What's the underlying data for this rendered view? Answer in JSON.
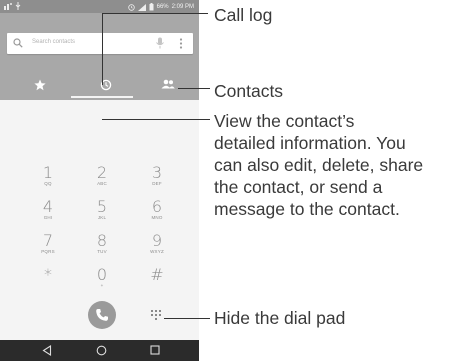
{
  "status_bar": {
    "battery": "66%",
    "time": "2:09 PM"
  },
  "search": {
    "placeholder": "Search contacts"
  },
  "tabs": [
    {
      "name": "favorites",
      "icon": "star-icon"
    },
    {
      "name": "call-log",
      "icon": "clock-icon",
      "selected": true
    },
    {
      "name": "contacts",
      "icon": "people-icon"
    }
  ],
  "dialpad": {
    "keys": [
      {
        "num": "1",
        "sub": "QQ"
      },
      {
        "num": "2",
        "sub": "ABC"
      },
      {
        "num": "3",
        "sub": "DEF"
      },
      {
        "num": "4",
        "sub": "GHI"
      },
      {
        "num": "5",
        "sub": "JKL"
      },
      {
        "num": "6",
        "sub": "MNO"
      },
      {
        "num": "7",
        "sub": "PQRS"
      },
      {
        "num": "8",
        "sub": "TUV"
      },
      {
        "num": "9",
        "sub": "WXYZ"
      },
      {
        "num": "*",
        "sub": ""
      },
      {
        "num": "0",
        "sub": "+"
      },
      {
        "num": "#",
        "sub": ""
      }
    ]
  },
  "callouts": {
    "call_log": "Call log",
    "contacts": "Contacts",
    "view_info_lines": [
      "View the contact’s",
      "detailed information. You",
      "can also edit, delete, share",
      "the contact, or send a",
      "message to the contact."
    ],
    "hide_dialpad": "Hide the dial pad"
  },
  "colors": {
    "appbar": "#a8a8a8",
    "status_bar": "#8e8e8e",
    "navbar": "#2b2b2b",
    "call_button": "#9a9a9a"
  }
}
